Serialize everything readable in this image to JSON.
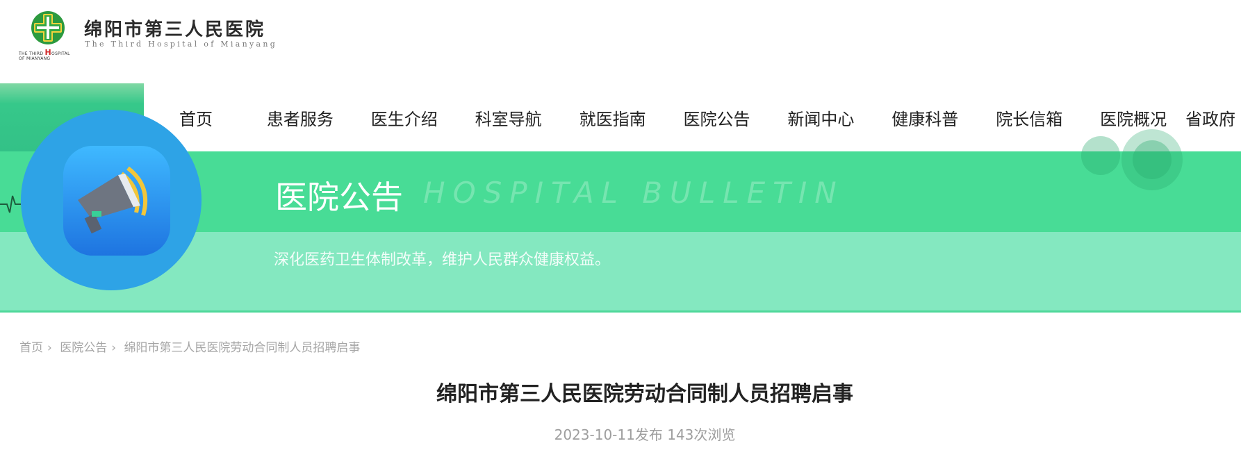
{
  "header": {
    "title": "绵阳市第三人民医院",
    "subtitle": "The Third Hospital of Mianyang",
    "logo_line1_a": "THE THIRD ",
    "logo_line1_h": "H",
    "logo_line1_b": "OSPITAL",
    "logo_line2": "OF MIANYANG"
  },
  "nav": {
    "items": [
      "首页",
      "患者服务",
      "医生介绍",
      "科室导航",
      "就医指南",
      "医院公告",
      "新闻中心",
      "健康科普",
      "院长信箱",
      "医院概况",
      "省政府"
    ]
  },
  "banner": {
    "title": "医院公告",
    "title_en": "HOSPITAL BULLETIN",
    "slogan": "深化医药卫生体制改革，维护人民群众健康权益。"
  },
  "breadcrumb": {
    "home": "首页",
    "sep": "›",
    "section": "医院公告",
    "current": "绵阳市第三人民医院劳动合同制人员招聘启事"
  },
  "article": {
    "title": "绵阳市第三人民医院劳动合同制人员招聘启事",
    "meta": "2023-10-11发布 143次浏览"
  },
  "colors": {
    "banner_top": "#48dc96",
    "banner_bottom": "#84e8c0",
    "icon_circle": "#2ea3e6"
  }
}
